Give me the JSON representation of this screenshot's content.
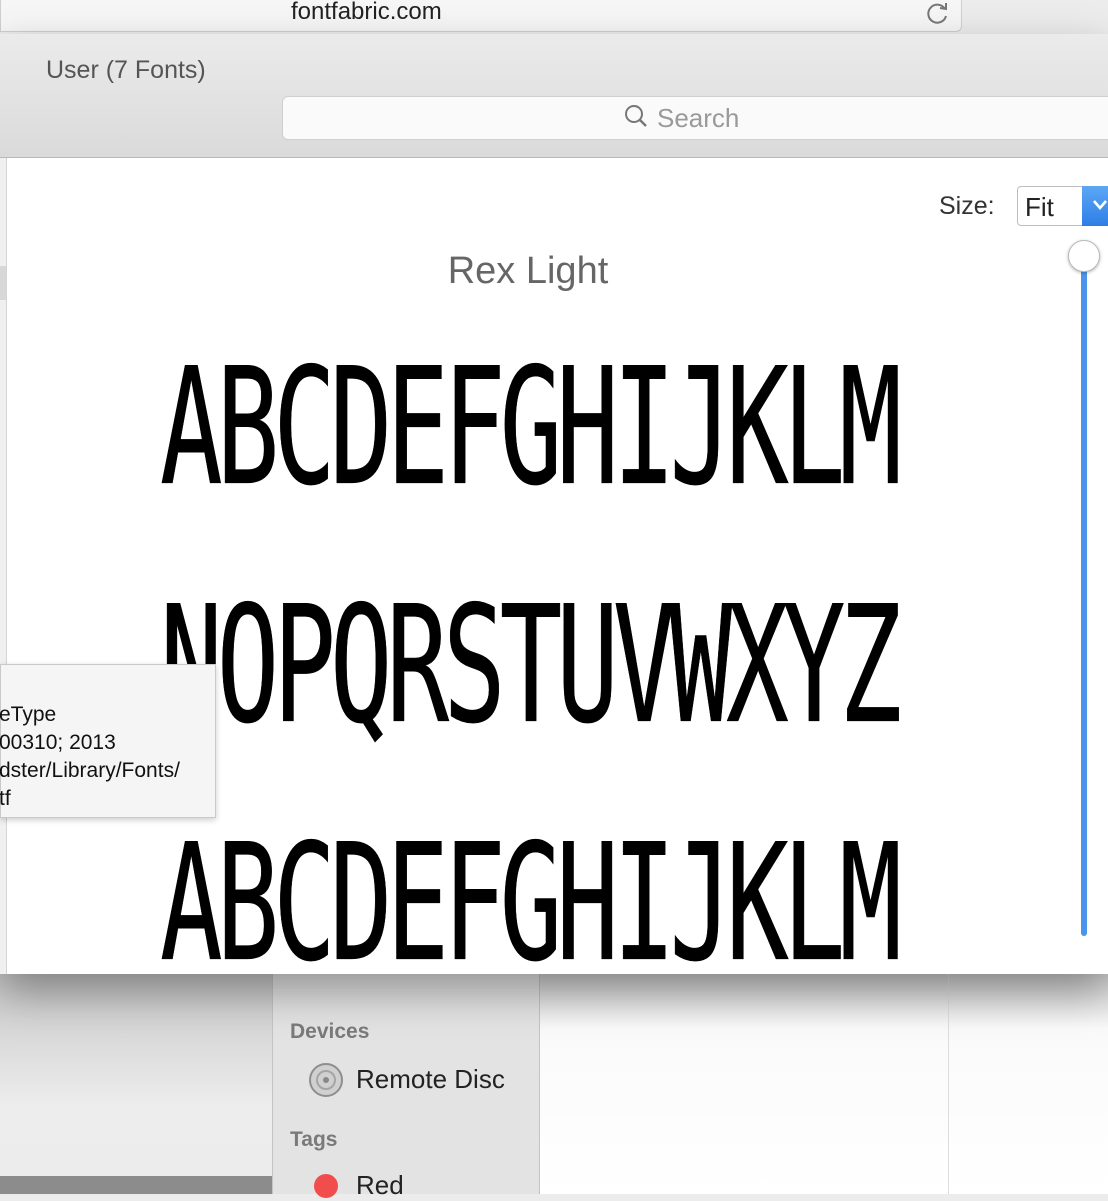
{
  "browser": {
    "url": "fontfabric.com"
  },
  "fontbook": {
    "collection_title": "User (7 Fonts)",
    "search_placeholder": "Search",
    "size_label": "Size:",
    "size_value": "Fit",
    "font_name": "Rex Light",
    "glyph_rows": [
      "ABCDEFGHIJKLM",
      "NOPQRSTUVWXYZ",
      "ABCDEFGHIJKLM"
    ],
    "tooltip_lines": [
      "eType",
      "00310; 2013",
      "dster/Library/Fonts/",
      "tf"
    ]
  },
  "finder": {
    "sidebar": {
      "devices_heading": "Devices",
      "remote_disc": "Remote Disc",
      "tags_heading": "Tags",
      "tag_red": "Red"
    },
    "tag_red_color": "#f24d4d"
  },
  "colors": {
    "accent": "#4a94ec"
  }
}
